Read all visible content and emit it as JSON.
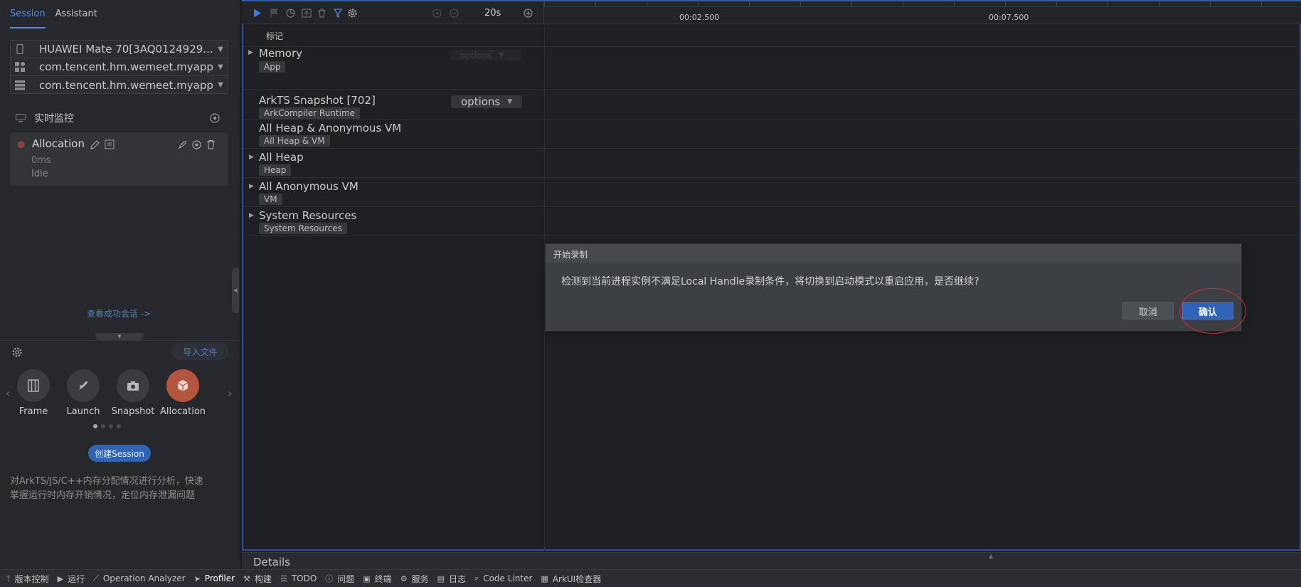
{
  "session_tabs": [
    {
      "label": "Session"
    },
    {
      "label": "Assistant"
    }
  ],
  "devices": [
    {
      "label": "HUAWEI Mate 70[3AQ0124929...",
      "icon": "phone-icon"
    },
    {
      "label": "com.tencent.hm.wemeet.myapp...",
      "icon": "app-grid-icon"
    },
    {
      "label": "com.tencent.hm.wemeet.myapp...",
      "icon": "process-icon"
    }
  ],
  "monitor": {
    "title": "实时监控"
  },
  "task": {
    "name": "Allocation",
    "time": "0ms",
    "status": "Idle"
  },
  "view_success_link": "查看成功会话 ->",
  "import_file": "导入文件",
  "templates": [
    {
      "label": "Frame",
      "icon": "frame-icon"
    },
    {
      "label": "Launch",
      "icon": "rocket-icon"
    },
    {
      "label": "Snapshot",
      "icon": "camera-icon"
    },
    {
      "label": "Allocation",
      "icon": "cube-icon"
    }
  ],
  "create_session": "创建Session",
  "description_line1": "对ArkTS/JS/C++内存分配情况进行分析，快速",
  "description_line2": "掌握运行时内存开销情况，定位内存泄漏问题",
  "toolbar": {
    "duration": "20s"
  },
  "timeline": {
    "tick1": "00:02.500",
    "tick2": "00:07.500"
  },
  "marker_row": "标记",
  "tracks": [
    {
      "name": "Memory",
      "tag": "App",
      "options": "options"
    },
    {
      "name": "ArkTS Snapshot [702]",
      "tag": "ArkCompiler Runtime",
      "options": "options"
    },
    {
      "name": "All Heap & Anonymous VM",
      "tag": "All Heap & VM"
    },
    {
      "name": "All Heap",
      "tag": "Heap"
    },
    {
      "name": "All Anonymous VM",
      "tag": "VM"
    },
    {
      "name": "System Resources",
      "tag": "System Resources"
    }
  ],
  "dialog": {
    "title": "开始录制",
    "message": "检测到当前进程实例不满足Local Handle录制条件，将切换到启动模式以重启应用，是否继续?",
    "cancel": "取消",
    "confirm": "确认"
  },
  "details_label": "Details",
  "statusbar": [
    {
      "label": "版本控制",
      "icon": "branch-icon"
    },
    {
      "label": "运行",
      "icon": "play-icon"
    },
    {
      "label": "Operation Analyzer",
      "icon": "chart-icon"
    },
    {
      "label": "Profiler",
      "icon": "profiler-icon"
    },
    {
      "label": "构建",
      "icon": "hammer-icon"
    },
    {
      "label": "TODO",
      "icon": "list-icon"
    },
    {
      "label": "问题",
      "icon": "info-icon"
    },
    {
      "label": "终端",
      "icon": "terminal-icon"
    },
    {
      "label": "服务",
      "icon": "services-icon"
    },
    {
      "label": "日志",
      "icon": "log-icon"
    },
    {
      "label": "Code Linter",
      "icon": "linter-icon"
    },
    {
      "label": "ArkUI检查器",
      "icon": "inspector-icon"
    }
  ],
  "colors": {
    "accent": "#2f63b5",
    "focus_border": "#2d4f9e",
    "highlight_ring": "#e02828",
    "allocation_icon": "#b5543f"
  }
}
